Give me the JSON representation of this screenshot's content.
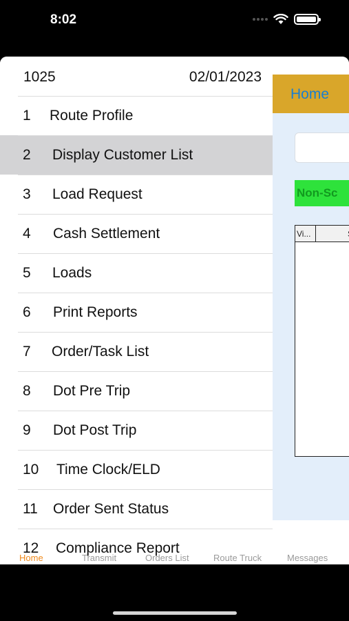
{
  "status_bar": {
    "time": "8:02",
    "icons": [
      "cellular-dots-icon",
      "wifi-icon",
      "battery-icon"
    ]
  },
  "drawer": {
    "header_left": "1025",
    "header_right": "02/01/2023",
    "items": [
      {
        "num": "1",
        "label": "Route Profile",
        "selected": false
      },
      {
        "num": "2",
        "label": "Display Customer List",
        "selected": true
      },
      {
        "num": "3",
        "label": "Load Request",
        "selected": false
      },
      {
        "num": "4",
        "label": "Cash Settlement",
        "selected": false
      },
      {
        "num": "5",
        "label": "Loads",
        "selected": false
      },
      {
        "num": "6",
        "label": "Print Reports",
        "selected": false
      },
      {
        "num": "7",
        "label": "Order/Task List",
        "selected": false
      },
      {
        "num": "8",
        "label": "Dot Pre Trip",
        "selected": false
      },
      {
        "num": "9",
        "label": "Dot Post Trip",
        "selected": false
      },
      {
        "num": "10",
        "label": "Time Clock/ELD",
        "selected": false
      },
      {
        "num": "11",
        "label": "Order Sent Status",
        "selected": false
      },
      {
        "num": "12",
        "label": "Compliance Report",
        "selected": false
      }
    ]
  },
  "home_screen": {
    "title": "Home",
    "badge": "Non-Sc",
    "grid_headers": [
      "Vi...",
      "S"
    ]
  },
  "tabs": [
    {
      "label": "Home",
      "active": true
    },
    {
      "label": "Transmit",
      "active": false
    },
    {
      "label": "Orders List",
      "active": false
    },
    {
      "label": "Route Truck",
      "active": false
    },
    {
      "label": "Messages",
      "active": false
    }
  ],
  "colors": {
    "header_gold": "#d9a62a",
    "title_blue": "#1a7fd0",
    "badge_green": "#2ee23b",
    "tab_active_orange": "#f08a1c",
    "selected_gray": "#d3d3d5"
  }
}
